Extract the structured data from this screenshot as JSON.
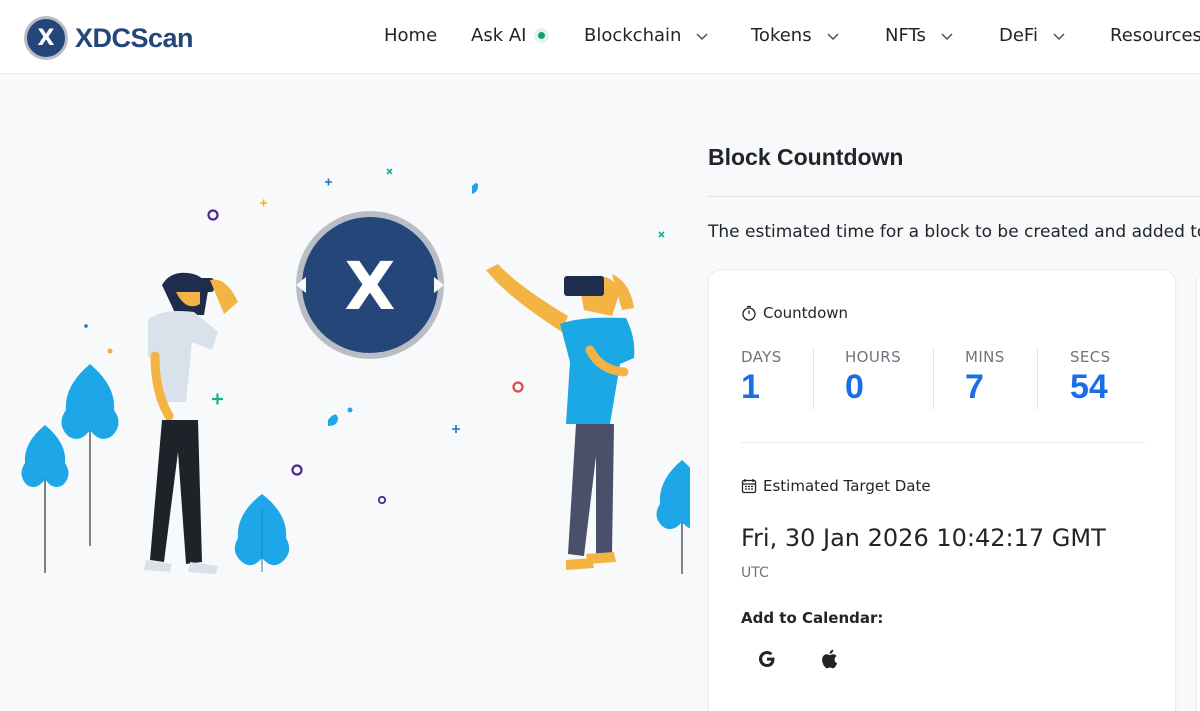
{
  "header": {
    "logo_text": "XDCScan",
    "logo_mark": "X",
    "nav": [
      {
        "label": "Home",
        "icon": null
      },
      {
        "label": "Ask AI",
        "icon": "status-dot"
      },
      {
        "label": "Blockchain",
        "icon": "chevron-down-icon"
      },
      {
        "label": "Tokens",
        "icon": "chevron-down-icon"
      },
      {
        "label": "NFTs",
        "icon": "chevron-down-icon"
      },
      {
        "label": "DeFi",
        "icon": "chevron-down-icon"
      },
      {
        "label": "Resources",
        "icon": null
      }
    ]
  },
  "illustration": {
    "center_mark": "X"
  },
  "main": {
    "title": "Block Countdown",
    "description": "The estimated time for a block to be created and added to"
  },
  "countdown": {
    "label": "Countdown",
    "icon": "stopwatch-icon",
    "days": {
      "unit": "DAYS",
      "value": "1"
    },
    "hours": {
      "unit": "HOURS",
      "value": "0"
    },
    "mins": {
      "unit": "MINS",
      "value": "7"
    },
    "secs": {
      "unit": "SECS",
      "value": "54"
    }
  },
  "target": {
    "label": "Estimated Target Date",
    "icon": "calendar-icon",
    "date": "Fri, 30 Jan 2026 10:42:17 GMT",
    "timezone": "UTC"
  },
  "calendar": {
    "label": "Add to Calendar:",
    "google_icon": "google-icon",
    "apple_icon": "apple-icon"
  },
  "colors": {
    "brand": "#244678",
    "accent": "#1a6ee8",
    "ai_dot": "#11a36d",
    "leaf": "#1ea7e8",
    "shirt_blue": "#1ca7e5"
  }
}
